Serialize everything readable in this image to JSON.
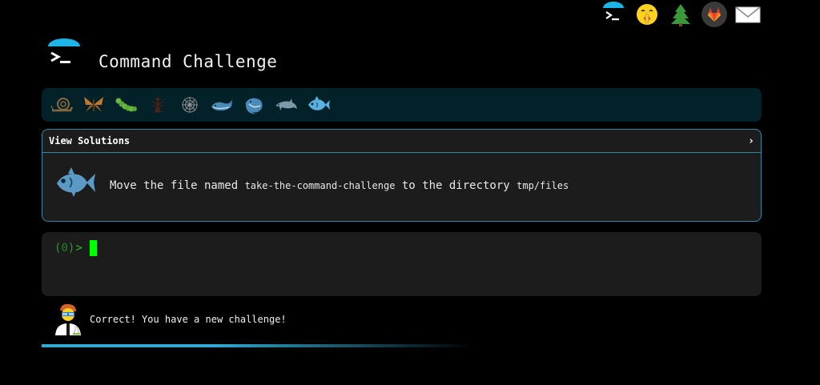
{
  "app": {
    "title": "Command Challenge"
  },
  "top_icons": [
    {
      "name": "terminal-icon"
    },
    {
      "name": "shush-emoji-icon"
    },
    {
      "name": "tree-icon"
    },
    {
      "name": "gitlab-icon"
    },
    {
      "name": "mail-icon"
    }
  ],
  "animals": [
    {
      "name": "snail-icon",
      "color": "#8a6a3a"
    },
    {
      "name": "butterfly-icon",
      "color": "#b5762a"
    },
    {
      "name": "caterpillar-icon",
      "color": "#5aa83a"
    },
    {
      "name": "ant-icon",
      "color": "#5a2a1a"
    },
    {
      "name": "spider-web-icon",
      "color": "#9a9a9a"
    },
    {
      "name": "whale-icon",
      "color": "#4a8ab8"
    },
    {
      "name": "spouting-whale-icon",
      "color": "#4a8ab8"
    },
    {
      "name": "dolphin-icon",
      "color": "#7a9aaa"
    },
    {
      "name": "fish-icon",
      "color": "#5ab0e0"
    }
  ],
  "challenge": {
    "header_label": "View Solutions",
    "chevron": "›",
    "text_before": "Move the file named ",
    "code_1": "take-the-command-challenge",
    "text_middle": " to the directory ",
    "code_2": "tmp/files"
  },
  "terminal": {
    "prompt_open": "(",
    "prompt_num": "0",
    "prompt_close": ")",
    "prompt_gt": ">"
  },
  "status": {
    "message": "Correct! You have a new challenge!"
  },
  "colors": {
    "accent": "#32a8d4",
    "panel_bg": "#1c1c1c",
    "animal_bar_bg": "#032129",
    "prompt_green": "#00ff00"
  }
}
